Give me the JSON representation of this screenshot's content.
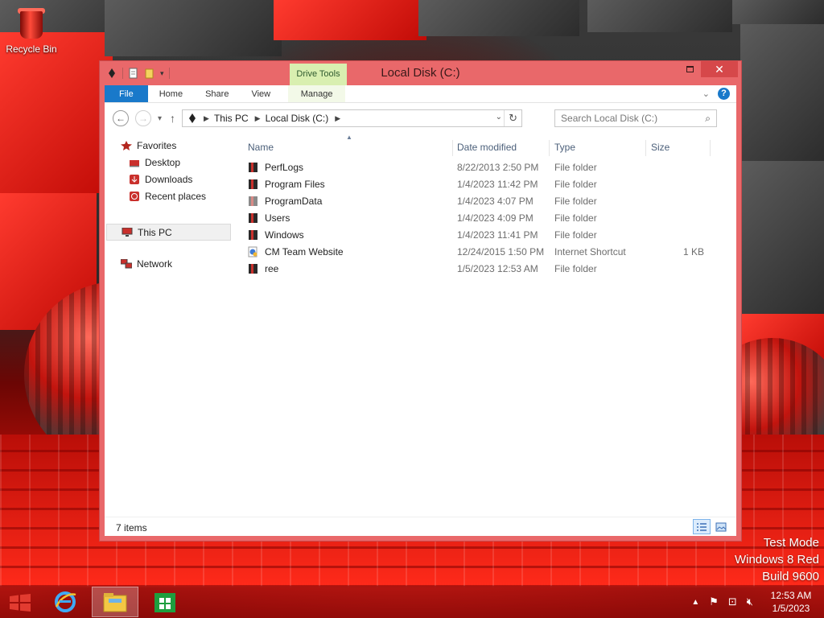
{
  "desktop": {
    "icons": [
      {
        "label": "Recycle Bin",
        "icon": "recycle-bin-icon"
      }
    ],
    "watermark": [
      "Test Mode",
      "Windows 8 Red",
      "Build 9600"
    ]
  },
  "window": {
    "title": "Local Disk (C:)",
    "context_tab_group": "Drive Tools",
    "buttons": {
      "minimize": "minimize-icon",
      "maximize": "maximize-icon",
      "close": "close-icon"
    },
    "close_color": "#d6484a",
    "frame_color": "#e9686a"
  },
  "ribbon": {
    "tabs": [
      "File",
      "Home",
      "Share",
      "View",
      "Manage"
    ],
    "file_color": "#1979ca",
    "context_color": "#d9efb0"
  },
  "address": {
    "breadcrumbs": [
      "This PC",
      "Local Disk (C:)"
    ],
    "search_placeholder": "Search Local Disk (C:)"
  },
  "navigation": {
    "favorites_label": "Favorites",
    "favorites": [
      "Desktop",
      "Downloads",
      "Recent places"
    ],
    "this_pc": "This PC",
    "network": "Network"
  },
  "file_list": {
    "columns": [
      "Name",
      "Date modified",
      "Type",
      "Size"
    ],
    "rows": [
      {
        "name": "PerfLogs",
        "date": "8/22/2013 2:50 PM",
        "type": "File folder",
        "size": "",
        "icon": "folder-icon"
      },
      {
        "name": "Program Files",
        "date": "1/4/2023 11:42 PM",
        "type": "File folder",
        "size": "",
        "icon": "folder-icon"
      },
      {
        "name": "ProgramData",
        "date": "1/4/2023 4:07 PM",
        "type": "File folder",
        "size": "",
        "icon": "folder-icon"
      },
      {
        "name": "Users",
        "date": "1/4/2023 4:09 PM",
        "type": "File folder",
        "size": "",
        "icon": "folder-icon"
      },
      {
        "name": "Windows",
        "date": "1/4/2023 11:41 PM",
        "type": "File folder",
        "size": "",
        "icon": "folder-icon"
      },
      {
        "name": "CM Team Website",
        "date": "12/24/2015 1:50 PM",
        "type": "Internet Shortcut",
        "size": "1 KB",
        "icon": "internet-shortcut-icon"
      },
      {
        "name": "ree",
        "date": "1/5/2023 12:53 AM",
        "type": "File folder",
        "size": "",
        "icon": "folder-icon"
      }
    ]
  },
  "status_bar": {
    "item_count": "7 items"
  },
  "taskbar": {
    "items": [
      "start-icon",
      "internet-explorer-icon",
      "file-explorer-icon",
      "store-icon"
    ],
    "clock_time": "12:53 AM",
    "clock_date": "1/5/2023"
  }
}
